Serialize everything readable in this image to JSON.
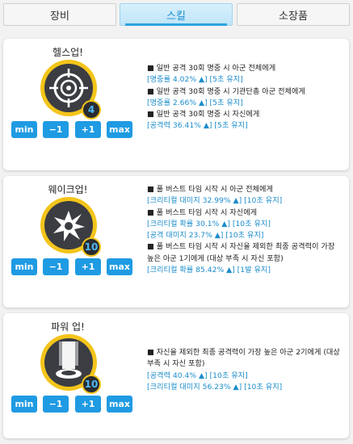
{
  "tabs": [
    {
      "label": "장비"
    },
    {
      "label": "스킬"
    },
    {
      "label": "소장품"
    }
  ],
  "buttons": {
    "min": "min",
    "minus": "−1",
    "plus": "+1",
    "max": "max"
  },
  "skills": [
    {
      "name": "헬스업!",
      "level": "4",
      "icon": "crosshair-icon",
      "lines": [
        {
          "type": "effect",
          "text": "일반 공격 30회 명중 시 아군 전체에게"
        },
        {
          "type": "stat",
          "text": "[명중률 4.02% ▲] [5초 유지]"
        },
        {
          "type": "effect",
          "text": "일반 공격 30회 명중 시 기관단총 아군 전체에게"
        },
        {
          "type": "stat",
          "text": "[명중률 2.66% ▲] [5초 유지]"
        },
        {
          "type": "effect",
          "text": "일반 공격 30회 명중 시 자신에게"
        },
        {
          "type": "stat",
          "text": "[공격력 36.41% ▲] [5초 유지]"
        }
      ]
    },
    {
      "name": "웨이크업!",
      "level": "10",
      "icon": "explosion-icon",
      "lines": [
        {
          "type": "effect",
          "text": "풀 버스트 타임 시작 시 아군 전체에게"
        },
        {
          "type": "stat",
          "text": "[크리티컬 대미지 32.99% ▲] [10초 유지]"
        },
        {
          "type": "effect",
          "text": "풀 버스트 타임 시작 시 자신에게"
        },
        {
          "type": "stat",
          "text": "[크리티컬 확률 30.1% ▲] [10초 유지]"
        },
        {
          "type": "stat",
          "text": "[공격 대미지 23.7% ▲] [10초 유지]"
        },
        {
          "type": "effect",
          "text": "풀 버스트 타임 시작 시 자신을 제외한 최종 공격력이 가장 높은 아군 1기에게 (대상 부족 시 자신 포함)"
        },
        {
          "type": "stat",
          "text": "[크리티컬 확률 85.42% ▲] [1발 유지]"
        }
      ]
    },
    {
      "name": "파워 업!",
      "level": "10",
      "icon": "power-beam-icon",
      "lines": [
        {
          "type": "effect",
          "text": "자신을 제외한 최종 공격력이 가장 높은 아군 2기에게 (대상 부족 시 자신 포함)"
        },
        {
          "type": "stat",
          "text": "[공격력 40.4% ▲] [10초 유지]"
        },
        {
          "type": "stat",
          "text": "[크리티컬 대미지 56.23% ▲] [10초 유지]"
        }
      ]
    }
  ]
}
